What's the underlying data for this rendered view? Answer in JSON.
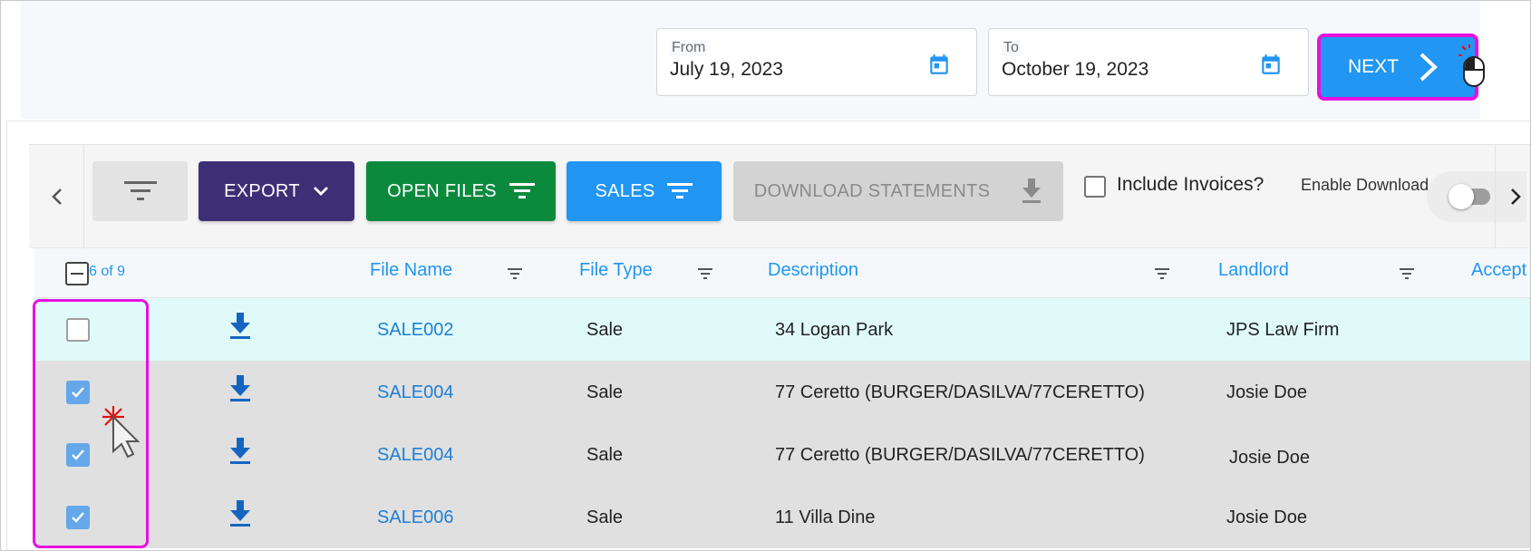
{
  "dates": {
    "from_label": "From",
    "from_value": "July 19, 2023",
    "to_label": "To",
    "to_value": "October 19, 2023"
  },
  "next_button": {
    "label": "NEXT"
  },
  "toolbar": {
    "export_label": "EXPORT",
    "open_files_label": "OPEN FILES",
    "sales_label": "SALES",
    "download_label": "DOWNLOAD STATEMENTS",
    "include_invoices_label": "Include Invoices?",
    "include_invoices_checked": false,
    "enable_download_label": "Enable Download All",
    "enable_download_on": false
  },
  "grid": {
    "selection_count": "6 of 9",
    "columns": [
      "File Name",
      "File Type",
      "Description",
      "Landlord",
      "Accept"
    ],
    "rows": [
      {
        "checked": false,
        "file_name": "SALE002",
        "file_type": "Sale",
        "description": "34 Logan Park",
        "landlord": "JPS Law Firm"
      },
      {
        "checked": true,
        "file_name": "SALE004",
        "file_type": "Sale",
        "description": "77 Ceretto (BURGER/DASILVA/77CERETTO)",
        "landlord": "Josie Doe"
      },
      {
        "checked": true,
        "file_name": "SALE004",
        "file_type": "Sale",
        "description": "77 Ceretto (BURGER/DASILVA/77CERETTO)",
        "landlord": "Josie Doe"
      },
      {
        "checked": true,
        "file_name": "SALE006",
        "file_type": "Sale",
        "description": "11 Villa Dine",
        "landlord": "Josie Doe"
      }
    ]
  },
  "colors": {
    "primary": "#2196f3",
    "export": "#3d2f75",
    "open_files": "#0b8a3e",
    "highlight": "#e810e0",
    "row_highlight": "#e0fafa",
    "row_selected": "#e0e0e0"
  }
}
